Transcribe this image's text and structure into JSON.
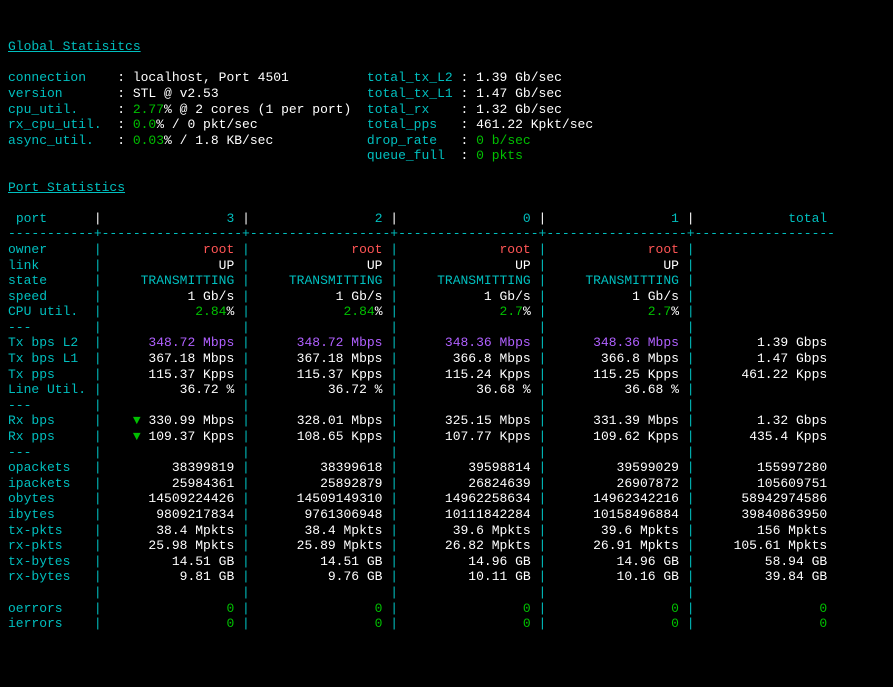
{
  "headers": {
    "global": "Global Statisitcs",
    "port": "Port Statistics"
  },
  "global": {
    "labels": {
      "connection": "connection",
      "version": "version",
      "cpu_util": "cpu_util.",
      "rx_cpu_util": "rx_cpu_util.",
      "async_util": "async_util.",
      "total_tx_l2": "total_tx_L2",
      "total_tx_l1": "total_tx_L1",
      "total_rx": "total_rx",
      "total_pps": "total_pps",
      "drop_rate": "drop_rate",
      "queue_full": "queue_full"
    },
    "connection": "localhost, Port 4501",
    "version": "STL @ v2.53",
    "cpu_util_pct": "2.77",
    "cpu_util_suffix": "% @ 2 cores (1 per port)",
    "rx_cpu_util_pct": "0.0",
    "rx_cpu_util_suffix": "% / 0 pkt/sec",
    "async_util_pct": "0.03",
    "async_util_suffix": "% / 1.8 KB/sec",
    "total_tx_l2": "1.39 Gb/sec",
    "total_tx_l1": "1.47 Gb/sec",
    "total_rx": "1.32 Gb/sec",
    "total_pps": "461.22 Kpkt/sec",
    "drop_rate": "0 b/sec",
    "queue_full": "0 pkts"
  },
  "port_table": {
    "col_header": "port",
    "col_total": "total",
    "cols": [
      "3",
      "2",
      "0",
      "1"
    ],
    "rows": {
      "owner": {
        "label": "owner",
        "vals": [
          "root",
          "root",
          "root",
          "root"
        ],
        "total": "",
        "cls": "red"
      },
      "link": {
        "label": "link",
        "vals": [
          "UP",
          "UP",
          "UP",
          "UP"
        ],
        "total": "",
        "cls": "white"
      },
      "state": {
        "label": "state",
        "vals": [
          "TRANSMITTING",
          "TRANSMITTING",
          "TRANSMITTING",
          "TRANSMITTING"
        ],
        "total": "",
        "cls": "cyan"
      },
      "speed": {
        "label": "speed",
        "vals": [
          "1 Gb/s",
          "1 Gb/s",
          "1 Gb/s",
          "1 Gb/s"
        ],
        "total": "",
        "cls": "white"
      },
      "cpuu": {
        "label": "CPU util.",
        "vals": [
          "2.84",
          "2.84",
          "2.7",
          "2.7"
        ],
        "total": "",
        "pct": true,
        "cls": "green"
      },
      "sep1": {
        "label": "---",
        "sep": true
      },
      "txl2": {
        "label": "Tx bps L2",
        "vals": [
          "348.72 Mbps",
          "348.72 Mbps",
          "348.36 Mbps",
          "348.36 Mbps"
        ],
        "total": "1.39 Gbps",
        "cls": "magenta",
        "totalcls": "white"
      },
      "txl1": {
        "label": "Tx bps L1",
        "vals": [
          "367.18 Mbps",
          "367.18 Mbps",
          "366.8 Mbps",
          "366.8 Mbps"
        ],
        "total": "1.47 Gbps",
        "cls": "white"
      },
      "txpps": {
        "label": "Tx pps",
        "vals": [
          "115.37 Kpps",
          "115.37 Kpps",
          "115.24 Kpps",
          "115.25 Kpps"
        ],
        "total": "461.22 Kpps",
        "cls": "white"
      },
      "lineu": {
        "label": "Line Util.",
        "vals": [
          "36.72 %",
          "36.72 %",
          "36.68 %",
          "36.68 %"
        ],
        "total": "",
        "cls": "white"
      },
      "sep2": {
        "label": "---",
        "sep": true
      },
      "rxbps": {
        "label": "Rx bps",
        "vals": [
          "330.99 Mbps",
          "328.01 Mbps",
          "325.15 Mbps",
          "331.39 Mbps"
        ],
        "total": "1.32 Gbps",
        "cls": "white",
        "mark0": true
      },
      "rxpps": {
        "label": "Rx pps",
        "vals": [
          "109.37 Kpps",
          "108.65 Kpps",
          "107.77 Kpps",
          "109.62 Kpps"
        ],
        "total": "435.4 Kpps",
        "cls": "white",
        "mark0": true
      },
      "sep3": {
        "label": "---",
        "sep": true
      },
      "opkts": {
        "label": "opackets",
        "vals": [
          "38399819",
          "38399618",
          "39598814",
          "39599029"
        ],
        "total": "155997280",
        "cls": "white"
      },
      "ipkts": {
        "label": "ipackets",
        "vals": [
          "25984361",
          "25892879",
          "26824639",
          "26907872"
        ],
        "total": "105609751",
        "cls": "white"
      },
      "obytes": {
        "label": "obytes",
        "vals": [
          "14509224426",
          "14509149310",
          "14962258634",
          "14962342216"
        ],
        "total": "58942974586",
        "cls": "white"
      },
      "ibytes": {
        "label": "ibytes",
        "vals": [
          "9809217834",
          "9761306948",
          "10111842284",
          "10158496884"
        ],
        "total": "39840863950",
        "cls": "white"
      },
      "txpkts": {
        "label": "tx-pkts",
        "vals": [
          "38.4 Mpkts",
          "38.4 Mpkts",
          "39.6 Mpkts",
          "39.6 Mpkts"
        ],
        "total": "156 Mpkts",
        "cls": "white"
      },
      "rxpkts": {
        "label": "rx-pkts",
        "vals": [
          "25.98 Mpkts",
          "25.89 Mpkts",
          "26.82 Mpkts",
          "26.91 Mpkts"
        ],
        "total": "105.61 Mpkts",
        "cls": "white"
      },
      "txbytes": {
        "label": "tx-bytes",
        "vals": [
          "14.51 GB",
          "14.51 GB",
          "14.96 GB",
          "14.96 GB"
        ],
        "total": "58.94 GB",
        "cls": "white"
      },
      "rxbytes": {
        "label": "rx-bytes",
        "vals": [
          "9.81 GB",
          "9.76 GB",
          "10.11 GB",
          "10.16 GB"
        ],
        "total": "39.84 GB",
        "cls": "white"
      },
      "sep4": {
        "label": "",
        "sep": true
      },
      "oerr": {
        "label": "oerrors",
        "vals": [
          "0",
          "0",
          "0",
          "0"
        ],
        "total": "0",
        "cls": "green"
      },
      "ierr": {
        "label": "ierrors",
        "vals": [
          "0",
          "0",
          "0",
          "0"
        ],
        "total": "0",
        "cls": "green"
      }
    },
    "row_order": [
      "owner",
      "link",
      "state",
      "speed",
      "cpuu",
      "sep1",
      "txl2",
      "txl1",
      "txpps",
      "lineu",
      "sep2",
      "rxbps",
      "rxpps",
      "sep3",
      "opkts",
      "ipkts",
      "obytes",
      "ibytes",
      "txpkts",
      "rxpkts",
      "txbytes",
      "rxbytes",
      "sep4",
      "oerr",
      "ierr"
    ]
  }
}
